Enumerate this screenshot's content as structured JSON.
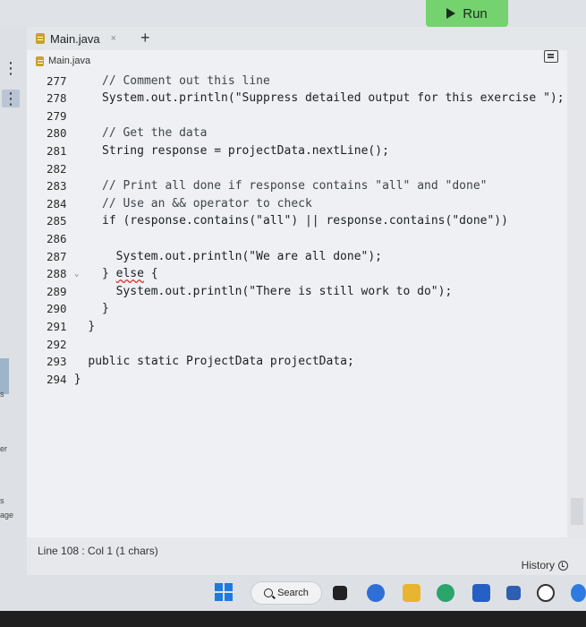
{
  "toolbar": {
    "run_label": "Run"
  },
  "left_strip": {
    "menu_glyph": "⋮",
    "fragments": [
      "s",
      "er",
      "s",
      "age"
    ]
  },
  "tabs": [
    {
      "label": "Main.java",
      "close": "×",
      "icon": "java-file-icon"
    }
  ],
  "tab_add": "+",
  "breadcrumb": {
    "file": "Main.java"
  },
  "code": [
    {
      "n": "277",
      "indent": 6,
      "text": "// Comment out this line",
      "kind": "comment"
    },
    {
      "n": "278",
      "indent": 6,
      "text": "System.out.println(\"Suppress detailed output for this exercise \");",
      "kind": "code"
    },
    {
      "n": "279",
      "indent": 0,
      "text": "",
      "kind": "code"
    },
    {
      "n": "280",
      "indent": 6,
      "text": "// Get the data",
      "kind": "comment"
    },
    {
      "n": "281",
      "indent": 6,
      "text": "String response = projectData.nextLine();",
      "kind": "code"
    },
    {
      "n": "282",
      "indent": 0,
      "text": "",
      "kind": "code"
    },
    {
      "n": "283",
      "indent": 6,
      "text": "// Print all done if response contains \"all\" and \"done\"",
      "kind": "comment"
    },
    {
      "n": "284",
      "indent": 6,
      "text": "// Use an && operator to check",
      "kind": "comment"
    },
    {
      "n": "285",
      "indent": 6,
      "text": "if (response.contains(\"all\") || response.contains(\"done\"))",
      "kind": "code"
    },
    {
      "n": "286",
      "indent": 0,
      "text": "",
      "kind": "code"
    },
    {
      "n": "287",
      "indent": 8,
      "text": "System.out.println(\"We are all done\");",
      "kind": "code"
    },
    {
      "n": "288",
      "indent": 6,
      "text": "} else {",
      "kind": "code",
      "fold": true
    },
    {
      "n": "289",
      "indent": 8,
      "text": "System.out.println(\"There is still work to do\");",
      "kind": "code"
    },
    {
      "n": "290",
      "indent": 6,
      "text": "}",
      "kind": "code"
    },
    {
      "n": "291",
      "indent": 4,
      "text": "}",
      "kind": "code"
    },
    {
      "n": "292",
      "indent": 0,
      "text": "",
      "kind": "code"
    },
    {
      "n": "293",
      "indent": 4,
      "text": "public static ProjectData projectData;",
      "kind": "code"
    },
    {
      "n": "294",
      "indent": 2,
      "text": "}",
      "kind": "code"
    }
  ],
  "status": {
    "position": "Line 108 : Col 1 (1 chars)",
    "history_label": "History"
  },
  "taskbar": {
    "search_label": "Search"
  },
  "colors": {
    "run_green": "#74d36f",
    "windows_blue": "#1f7ae0"
  }
}
